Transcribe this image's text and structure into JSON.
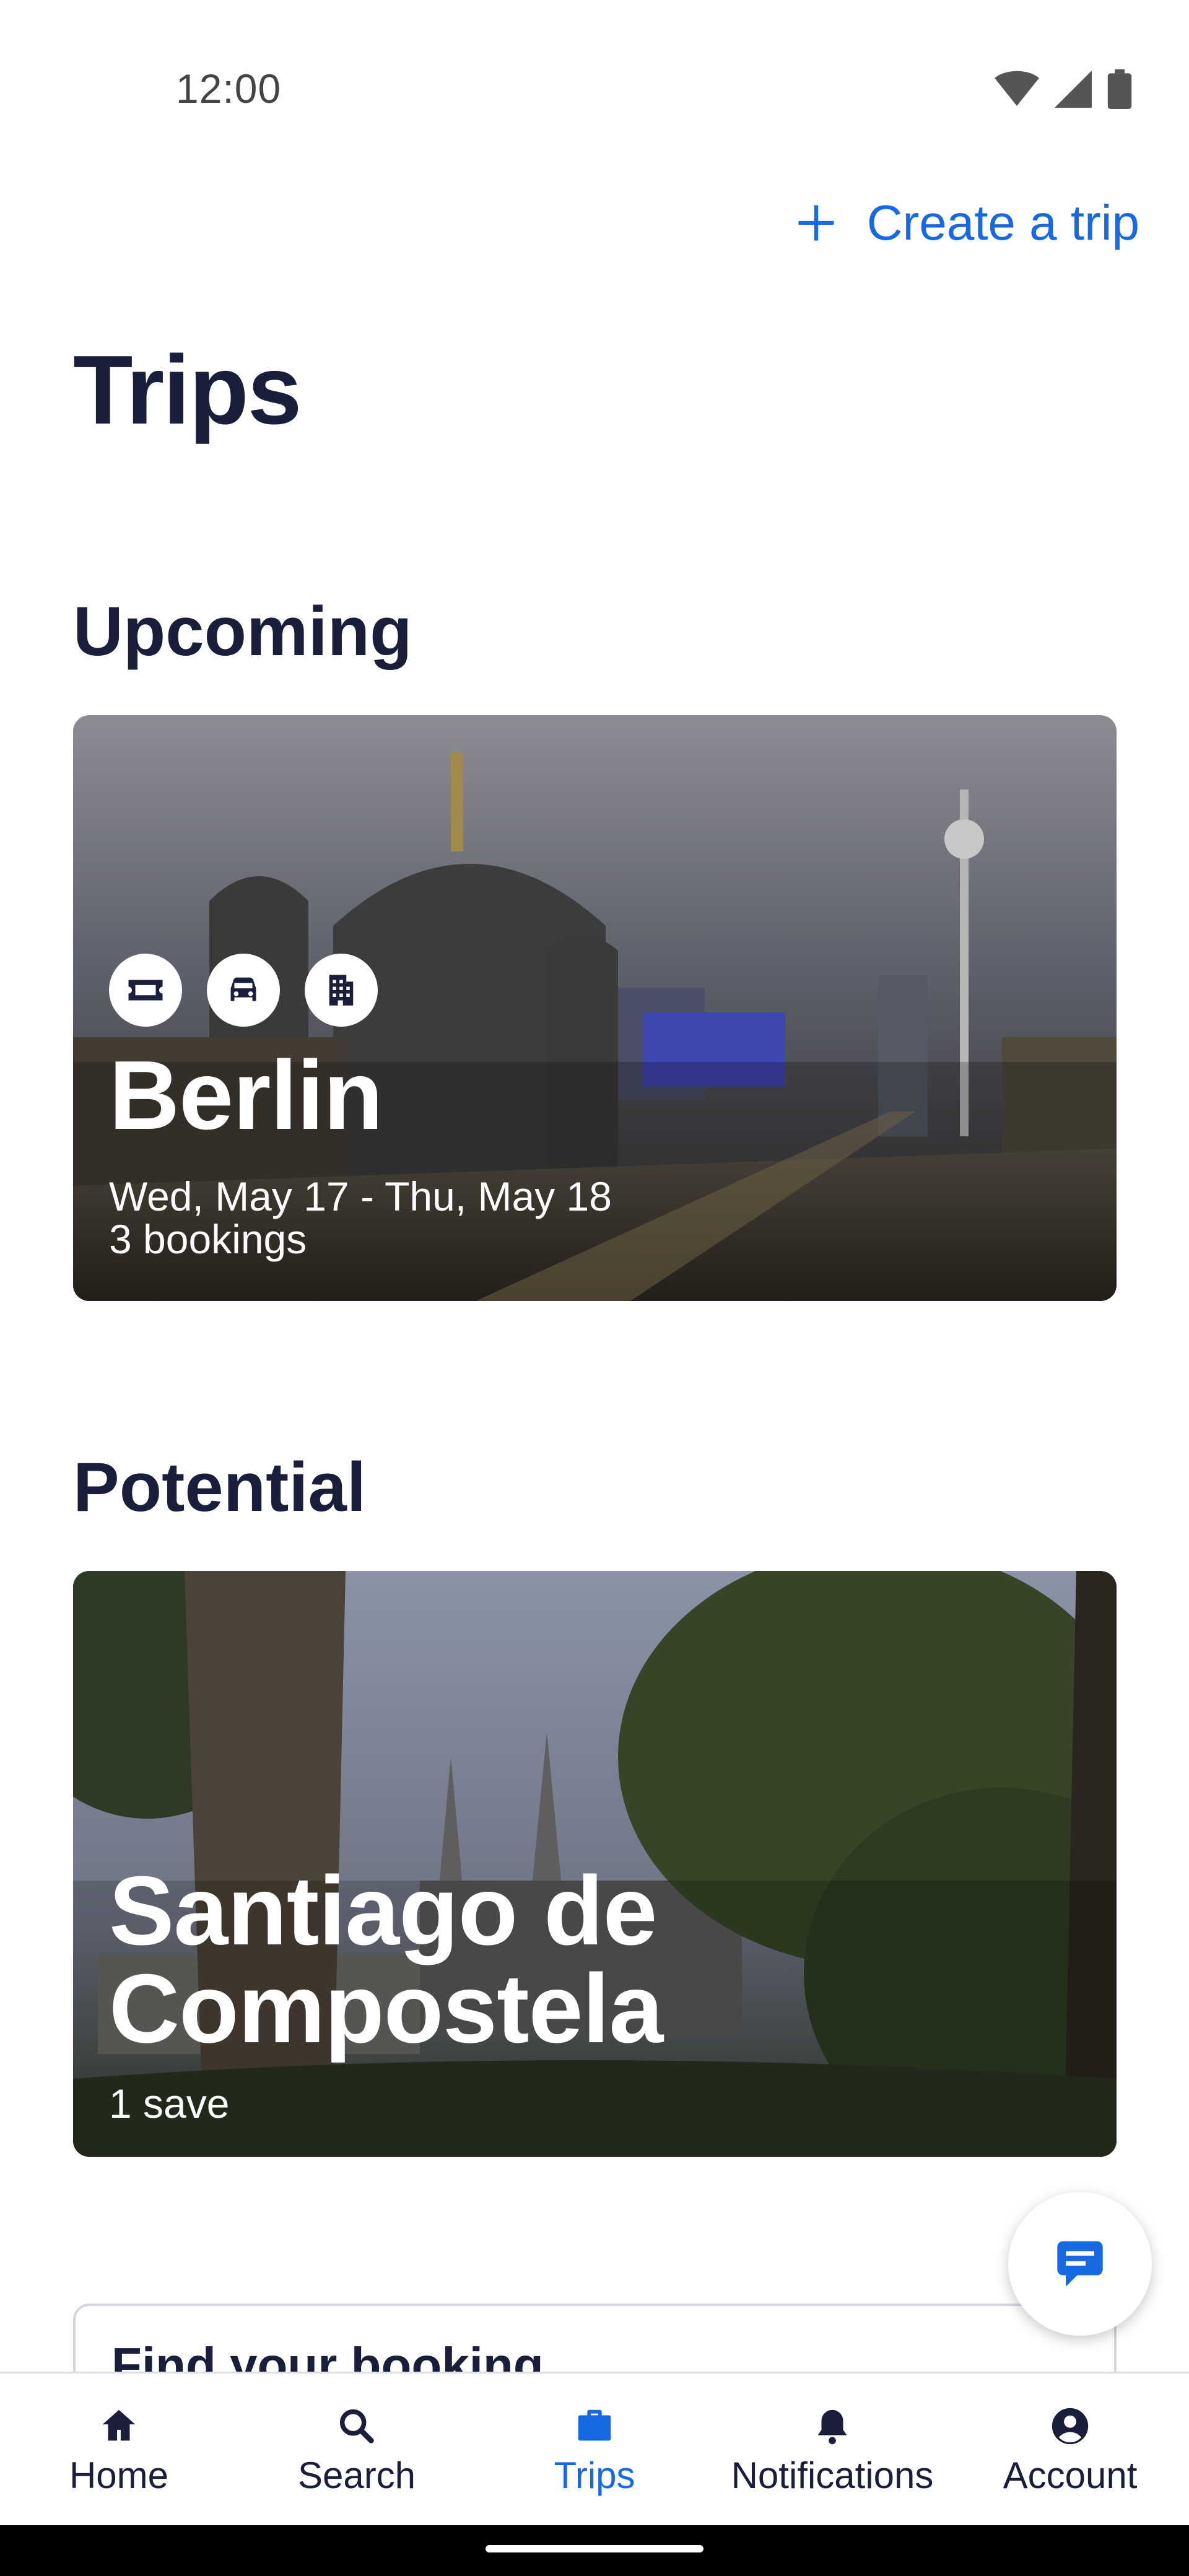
{
  "status_bar": {
    "time": "12:00"
  },
  "header": {
    "create_trip_label": "Create a trip"
  },
  "page": {
    "title": "Trips"
  },
  "sections": {
    "upcoming": {
      "title": "Upcoming",
      "trip": {
        "name": "Berlin",
        "dates": "Wed, May 17 - Thu, May 18",
        "bookings": "3 bookings",
        "booking_icons": [
          "ticket-icon",
          "car-icon",
          "hotel-icon"
        ]
      }
    },
    "potential": {
      "title": "Potential",
      "trip": {
        "name_line1": "Santiago de",
        "name_line2": "Compostela",
        "saves": "1 save"
      }
    }
  },
  "find_booking": {
    "label": "Find your booking"
  },
  "bottom_nav": {
    "items": [
      {
        "label": "Home",
        "icon": "home-icon"
      },
      {
        "label": "Search",
        "icon": "search-icon"
      },
      {
        "label": "Trips",
        "icon": "briefcase-icon",
        "active": true
      },
      {
        "label": "Notifications",
        "icon": "bell-icon"
      },
      {
        "label": "Account",
        "icon": "account-icon"
      }
    ]
  },
  "colors": {
    "primary": "#1668e3",
    "text": "#191e3b",
    "background": "#ffffff"
  }
}
